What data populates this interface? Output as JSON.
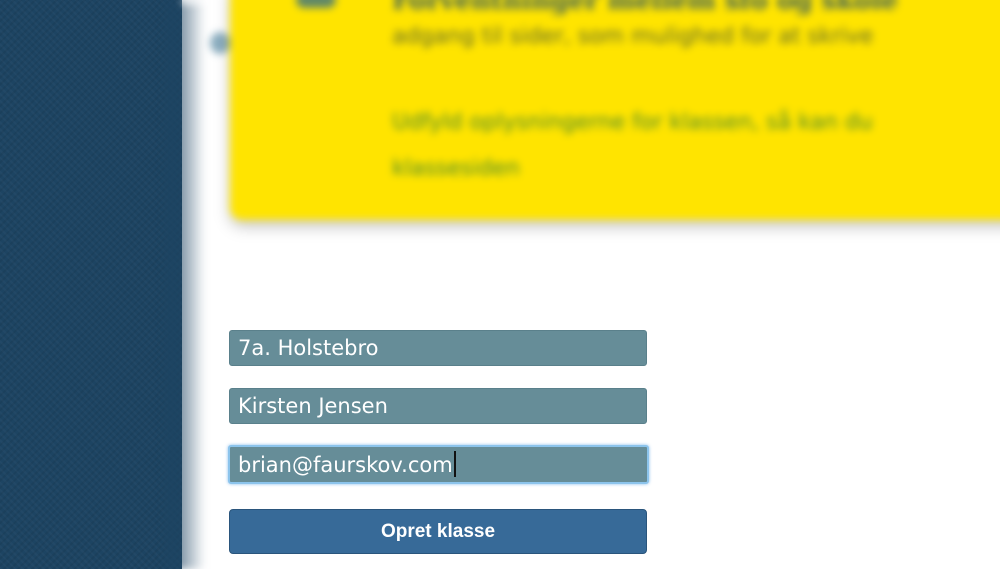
{
  "form": {
    "class_name_value": "7a. Holstebro",
    "teacher_name_value": "Kirsten Jensen",
    "email_value": "brian@faurskov.com",
    "submit_label": "Opret klasse"
  },
  "colors": {
    "sidebar": "#1d4462",
    "notice_background": "#ffe400",
    "field_background": "#668d98",
    "button_background": "#376a98",
    "focus_ring": "#8cc4ec"
  }
}
